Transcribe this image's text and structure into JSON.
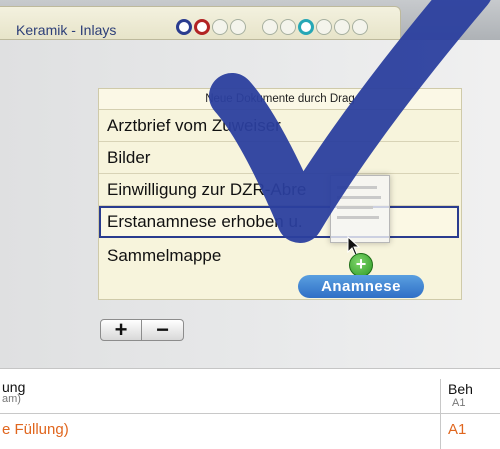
{
  "tab": {
    "title": "Keramik - Inlays",
    "status_dots": [
      "filled",
      "red",
      "empty",
      "empty",
      "empty",
      "empty",
      "cyan",
      "empty",
      "empty",
      "empty"
    ]
  },
  "document_list": {
    "header": "Neue Dokumente durch Drag",
    "items": [
      "Arztbrief vom Zuweiser",
      "Bilder",
      "Einwilligung zur DZR-Abre",
      "Erstanamnese erhoben u.",
      "Sammelmappe"
    ],
    "selected_index": 3
  },
  "drag": {
    "pill_label": "Anamnese",
    "badge": "+"
  },
  "buttons": {
    "add": "+",
    "remove": "−"
  },
  "table": {
    "col1_header": "ung",
    "col1_subheader": "am)",
    "col2_header": "Beh",
    "col2_subheader": "A1",
    "row1_col1": "e Füllung)",
    "row1_col2": "A1"
  },
  "colors": {
    "accent": "#2a3c8f",
    "drag_pill": "#3a7fd0",
    "table_text": "#e0661e",
    "checkmark": "#2b3f9e"
  }
}
